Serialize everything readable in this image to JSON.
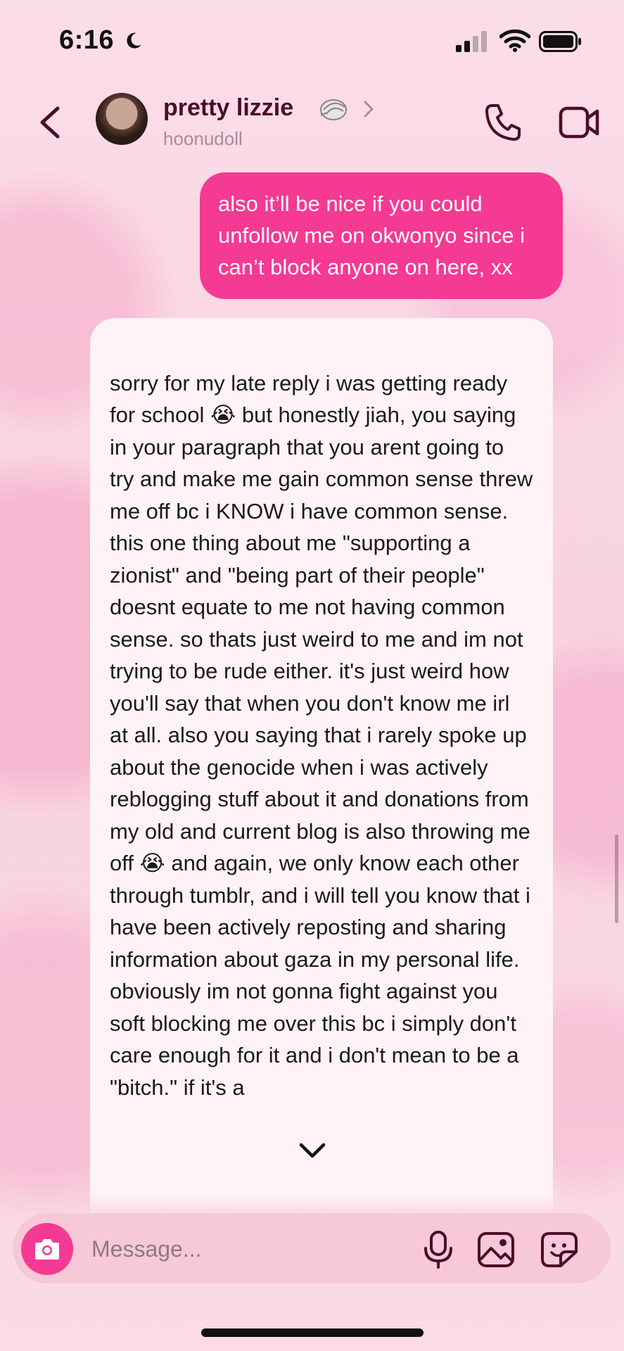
{
  "status_bar": {
    "time": "6:16",
    "focus_icon": "moon-icon",
    "signal_icon": "cellular-signal-icon",
    "wifi_icon": "wifi-icon",
    "battery_icon": "battery-icon"
  },
  "header": {
    "name": "pretty lizzie",
    "name_emoji_icon": "shell-icon",
    "username": "hoonudoll",
    "back_icon": "chevron-left-icon",
    "call_icon": "phone-icon",
    "video_icon": "video-camera-icon"
  },
  "messages": [
    {
      "direction": "sent",
      "text": "also it’ll be nice if you could unfollow me on okwonyo since i can’t block anyone on here, xx"
    },
    {
      "direction": "received",
      "text": "sorry for my late reply i was getting ready for school 😭 but honestly jiah, you saying in your paragraph that you arent going to try and make me gain common sense threw me off bc i KNOW i have common sense. this one thing about me \"supporting a zionist\" and \"being part of their people\" doesnt equate to me not having common sense. so thats just weird to me and im not trying to be rude either. it's just weird how you'll say that when you don't know me irl at all. also you saying that i rarely spoke up about the genocide when i was actively reblogging stuff about it and donations from my old and current blog is also throwing me off 😭 and again, we only know each other through tumblr, and i will tell you know that i have been actively reposting and sharing information about gaza in my personal life. obviously im not gonna fight against you soft blocking me over this bc i simply don't care enough for it and i don't mean to be a \"bitch.\" if it's a"
    }
  ],
  "composer": {
    "placeholder": "Message...",
    "camera_icon": "camera-icon",
    "mic_icon": "microphone-icon",
    "gallery_icon": "image-icon",
    "sticker_icon": "sticker-icon"
  },
  "colors": {
    "sent_bubble": "#f43a93",
    "received_bubble": "#fff3f6",
    "name": "#4a0d2a",
    "background": "#f9d3e1"
  }
}
